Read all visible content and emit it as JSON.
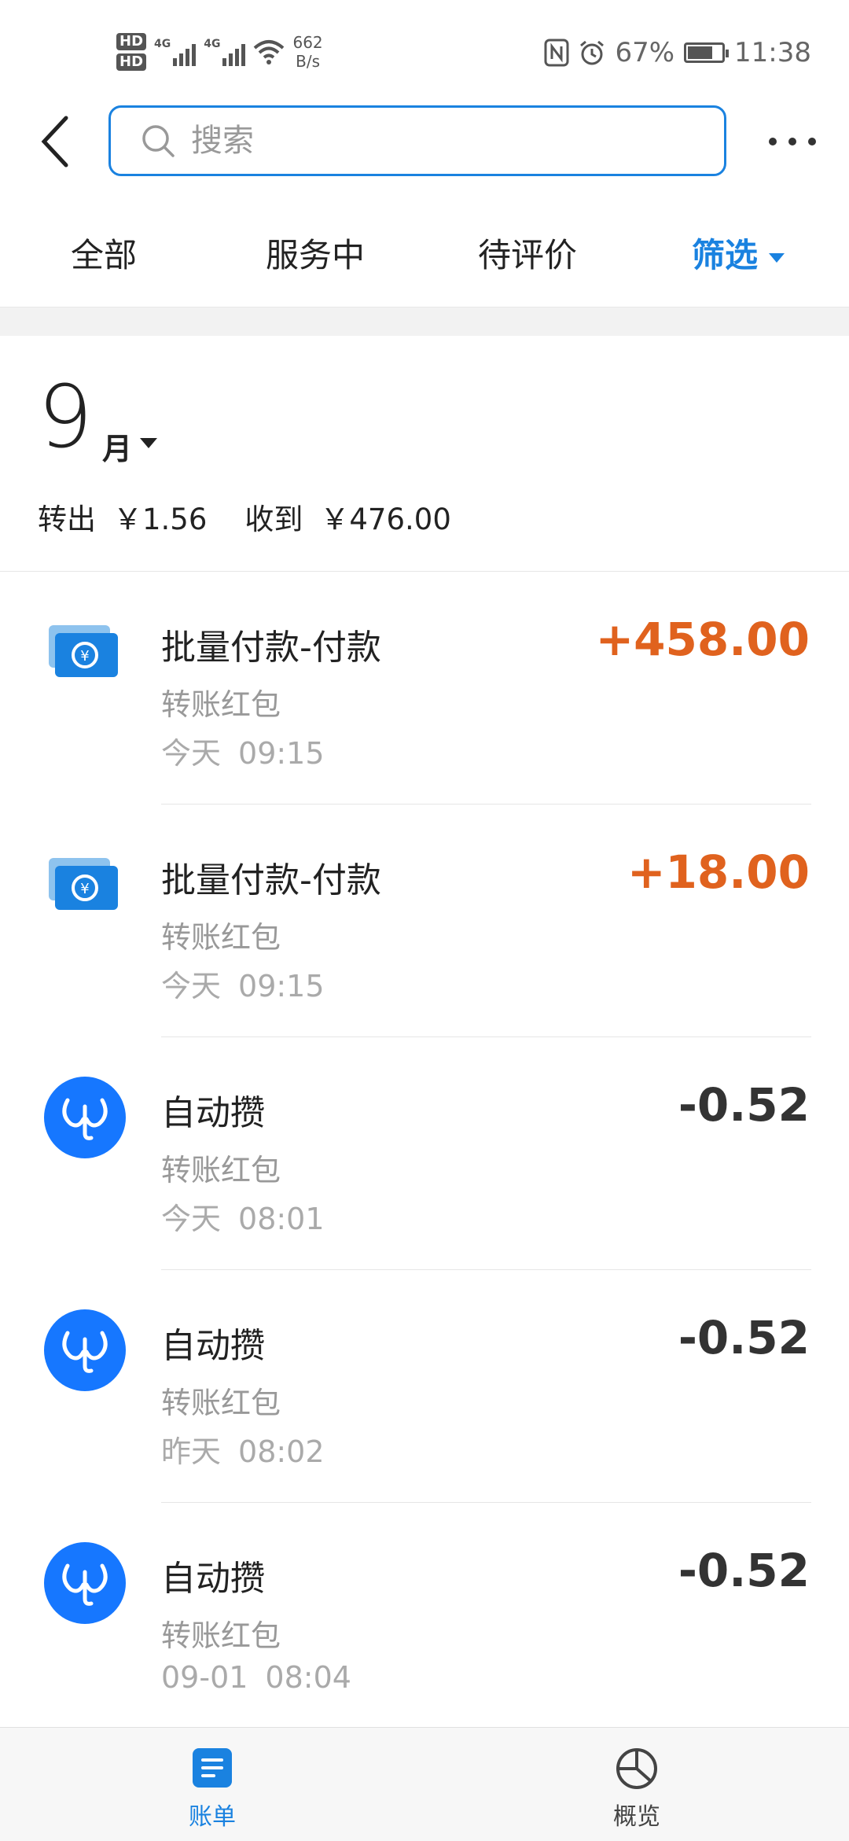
{
  "status_bar": {
    "hd1": "HD",
    "hd2": "HD",
    "net1": "4G",
    "net2": "4G",
    "speed_value": "662",
    "speed_unit": "B/s",
    "battery": "67%",
    "battery_level": 0.67,
    "time": "11:38"
  },
  "header": {
    "search_placeholder": "搜索"
  },
  "tabs": [
    {
      "label": "全部"
    },
    {
      "label": "服务中"
    },
    {
      "label": "待评价"
    },
    {
      "label": "筛选"
    }
  ],
  "month": {
    "number": "9",
    "unit": "月",
    "out_label": "转出",
    "out_amount": "￥1.56",
    "in_label": "收到",
    "in_amount": "￥476.00"
  },
  "transactions": [
    {
      "title": "批量付款-付款",
      "category": "转账红包",
      "day": "今天",
      "time": "09:15",
      "amount": "+458.00",
      "icon": "transfer-card-icon"
    },
    {
      "title": "批量付款-付款",
      "category": "转账红包",
      "day": "今天",
      "time": "09:15",
      "amount": "+18.00",
      "icon": "transfer-card-icon"
    },
    {
      "title": "自动攒",
      "category": "转账红包",
      "day": "今天",
      "time": "08:01",
      "amount": "-0.52",
      "icon": "elephant-icon"
    },
    {
      "title": "自动攒",
      "category": "转账红包",
      "day": "昨天",
      "time": "08:02",
      "amount": "-0.52",
      "icon": "elephant-icon"
    },
    {
      "title": "自动攒",
      "category": "转账红包",
      "day": "09-01",
      "time": "08:04",
      "amount": "-0.52",
      "icon": "elephant-icon"
    }
  ],
  "bottom_nav": {
    "bills": "账单",
    "overview": "概览"
  },
  "colors": {
    "accent": "#1a82e0",
    "income": "#e0621e"
  }
}
